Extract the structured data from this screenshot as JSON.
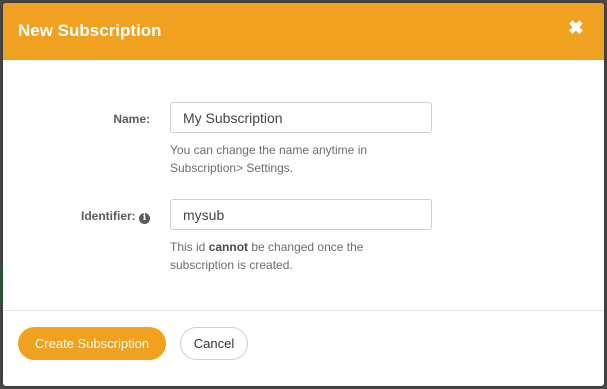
{
  "dialog": {
    "title": "New Subscription",
    "close_icon": "close-icon",
    "close_glyph": "✖"
  },
  "form": {
    "name": {
      "label": "Name:",
      "value": "My Subscription",
      "help": "You can change the name anytime in Subscription> Settings."
    },
    "identifier": {
      "label": "Identifier:",
      "info_icon": "info-icon",
      "info_glyph": "i",
      "value": "mysub",
      "help_before": "This id ",
      "help_bold": "cannot",
      "help_after": " be changed once the subscription is created."
    }
  },
  "footer": {
    "create_label": "Create Subscription",
    "cancel_label": "Cancel"
  },
  "colors": {
    "accent": "#f0a11f",
    "backdrop": "#4a4a4a"
  }
}
